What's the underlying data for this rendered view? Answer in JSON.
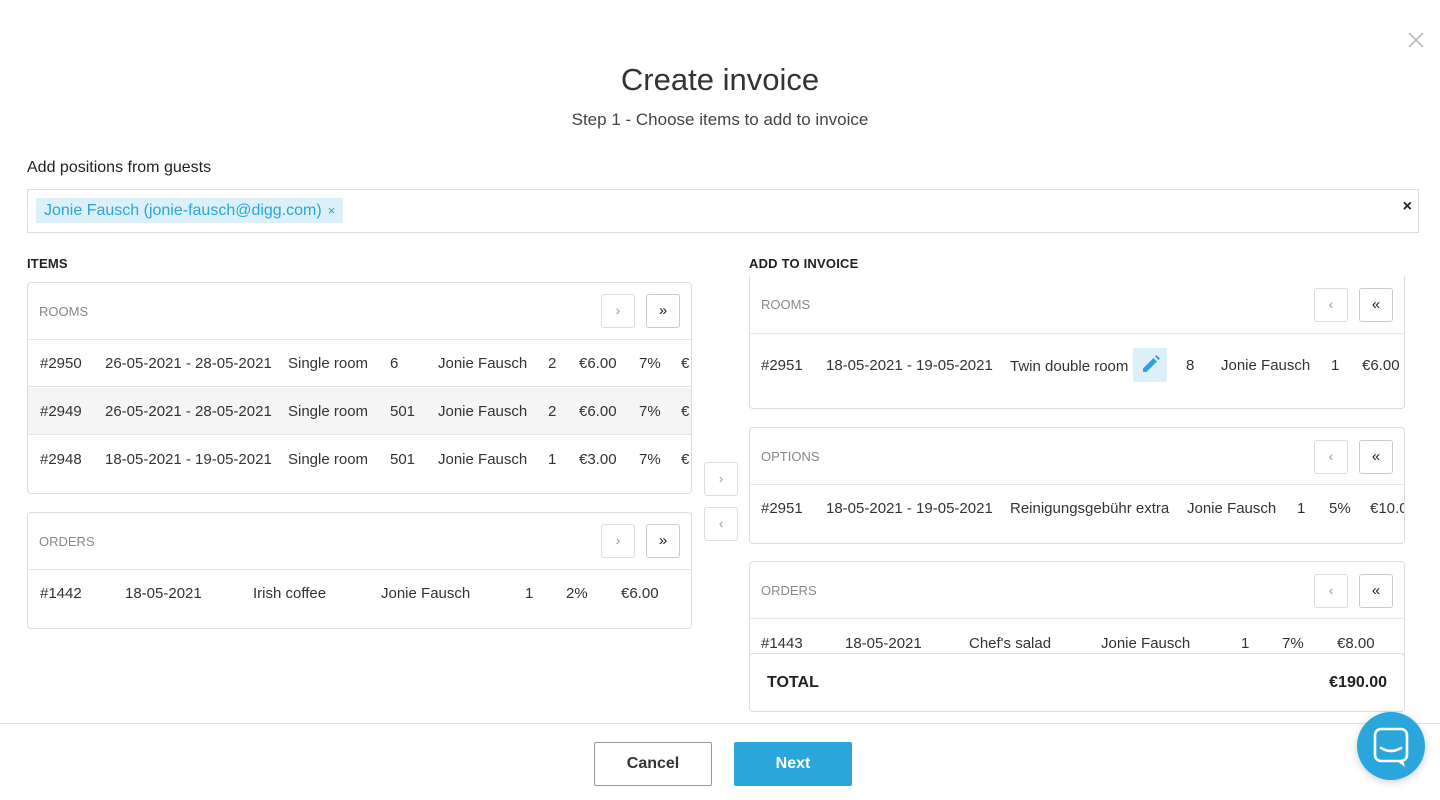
{
  "header": {
    "title": "Create invoice",
    "subtitle": "Step 1 - Choose items to add to invoice"
  },
  "guests": {
    "label": "Add positions from guests",
    "tag": "Jonie Fausch (jonie-fausch@digg.com)",
    "tag_remove": "×",
    "clear": "×"
  },
  "items": {
    "label": "ITEMS",
    "rooms": {
      "caption": "ROOMS",
      "rows": [
        {
          "id": "#2950",
          "dates": "26-05-2021 - 28-05-2021",
          "type": "Single room",
          "room": "6",
          "guest": "Jonie Fausch",
          "qty": "2",
          "price": "€6.00",
          "tax": "7%",
          "total": "€"
        },
        {
          "id": "#2949",
          "dates": "26-05-2021 - 28-05-2021",
          "type": "Single room",
          "room": "501",
          "guest": "Jonie Fausch",
          "qty": "2",
          "price": "€6.00",
          "tax": "7%",
          "total": "€"
        },
        {
          "id": "#2948",
          "dates": "18-05-2021 - 19-05-2021",
          "type": "Single room",
          "room": "501",
          "guest": "Jonie Fausch",
          "qty": "1",
          "price": "€3.00",
          "tax": "7%",
          "total": "€"
        }
      ]
    },
    "orders": {
      "caption": "ORDERS",
      "rows": [
        {
          "id": "#1442",
          "date": "18-05-2021",
          "item": "Irish coffee",
          "guest": "Jonie Fausch",
          "qty": "1",
          "tax": "2%",
          "price": "€6.00"
        }
      ]
    }
  },
  "invoice": {
    "label": "ADD TO INVOICE",
    "rooms": {
      "caption": "ROOMS",
      "rows": [
        {
          "id": "#2951",
          "dates": "18-05-2021 - 19-05-2021",
          "type": "Twin double room",
          "room": "8",
          "guest": "Jonie Fausch",
          "qty": "1",
          "price": "€6.00"
        }
      ]
    },
    "options": {
      "caption": "OPTIONS",
      "rows": [
        {
          "id": "#2951",
          "dates": "18-05-2021 - 19-05-2021",
          "item": "Reinigungsgebühr extra",
          "guest": "Jonie Fausch",
          "qty": "1",
          "tax": "5%",
          "price": "€10.0"
        }
      ]
    },
    "orders": {
      "caption": "ORDERS",
      "rows": [
        {
          "id": "#1443",
          "date": "18-05-2021",
          "item": "Chef's salad",
          "guest": "Jonie Fausch",
          "qty": "1",
          "tax": "7%",
          "price": "€8.00"
        }
      ]
    },
    "total_label": "TOTAL",
    "total_value": "€190.00"
  },
  "buttons": {
    "single_right": "›",
    "all_right": "»",
    "single_left": "‹",
    "all_left": "«",
    "cancel": "Cancel",
    "next": "Next"
  },
  "colors": {
    "accent": "#2aa6dc",
    "tag_bg": "#dcf0f9",
    "row_shaded": "#f5f5f5"
  },
  "icons": [
    "close-icon",
    "pencil-icon",
    "chat-icon"
  ]
}
